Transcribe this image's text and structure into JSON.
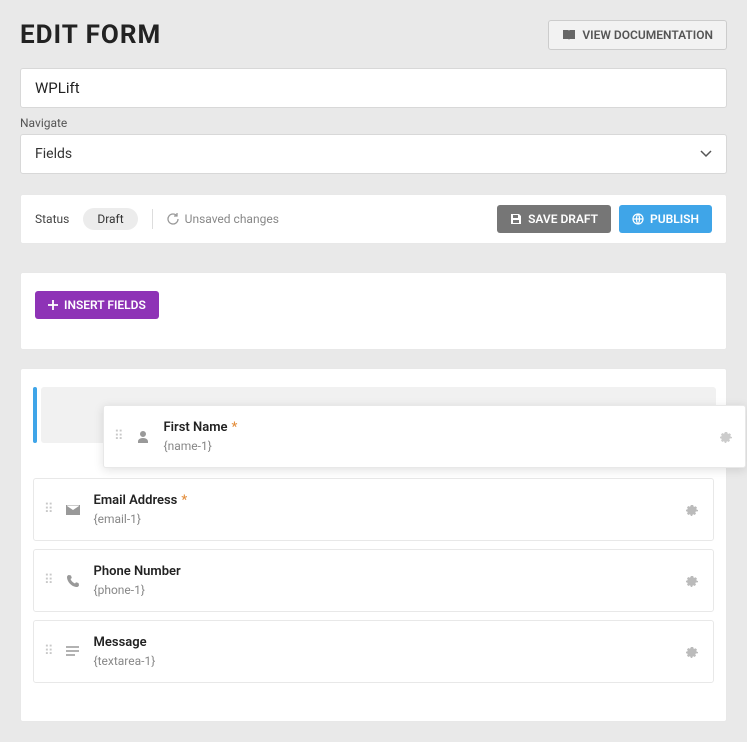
{
  "header": {
    "title": "EDIT FORM",
    "view_docs": "VIEW DOCUMENTATION"
  },
  "form": {
    "title": "WPLift",
    "navigate_label": "Navigate",
    "navigate_value": "Fields"
  },
  "statusbar": {
    "label": "Status",
    "pill": "Draft",
    "unsaved": "Unsaved changes",
    "save_draft": "SAVE DRAFT",
    "publish": "PUBLISH"
  },
  "insert_fields": "INSERT FIELDS",
  "fields": [
    {
      "label": "First Name",
      "slug": "{name-1}",
      "required": true,
      "icon": "person"
    },
    {
      "label": "Email Address",
      "slug": "{email-1}",
      "required": true,
      "icon": "mail"
    },
    {
      "label": "Phone Number",
      "slug": "{phone-1}",
      "required": false,
      "icon": "phone"
    },
    {
      "label": "Message",
      "slug": "{textarea-1}",
      "required": false,
      "icon": "textarea"
    }
  ]
}
